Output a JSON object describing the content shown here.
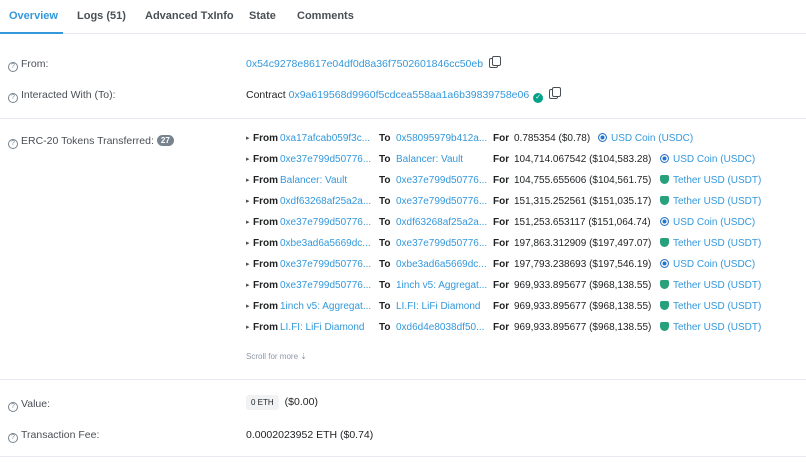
{
  "tabs": [
    {
      "label": "Overview"
    },
    {
      "label": "Logs (51)"
    },
    {
      "label": "Advanced TxInfo"
    },
    {
      "label": "State"
    },
    {
      "label": "Comments"
    }
  ],
  "from": {
    "label": "From:",
    "address": "0x54c9278e8617e04df0d8a36f7502601846cc50eb"
  },
  "interacted": {
    "label": "Interacted With (To):",
    "prefix": "Contract",
    "address": "0x9a619568d9960f5cdcea558aa1a6b39839758e06"
  },
  "erc20": {
    "label": "ERC-20 Tokens Transferred:",
    "count": "27",
    "kw_from": "From",
    "kw_to": "To",
    "kw_for": "For",
    "transfers": [
      {
        "from": "0xa17afcab059f3c...",
        "to": "0x58095979b412a...",
        "amount": "0.785354 ($0.78)",
        "token": "USD Coin (USDC)",
        "token_type": "usdc"
      },
      {
        "from": "0xe37e799d50776...",
        "to": "Balancer: Vault",
        "amount": "104,714.067542 ($104,583.28)",
        "token": "USD Coin (USDC)",
        "token_type": "usdc"
      },
      {
        "from": "Balancer: Vault",
        "to": "0xe37e799d50776...",
        "amount": "104,755.655606 ($104,561.75)",
        "token": "Tether USD (USDT)",
        "token_type": "usdt"
      },
      {
        "from": "0xdf63268af25a2a...",
        "to": "0xe37e799d50776...",
        "amount": "151,315.252561 ($151,035.17)",
        "token": "Tether USD (USDT)",
        "token_type": "usdt"
      },
      {
        "from": "0xe37e799d50776...",
        "to": "0xdf63268af25a2a...",
        "amount": "151,253.653117 ($151,064.74)",
        "token": "USD Coin (USDC)",
        "token_type": "usdc"
      },
      {
        "from": "0xbe3ad6a5669dc...",
        "to": "0xe37e799d50776...",
        "amount": "197,863.312909 ($197,497.07)",
        "token": "Tether USD (USDT)",
        "token_type": "usdt"
      },
      {
        "from": "0xe37e799d50776...",
        "to": "0xbe3ad6a5669dc...",
        "amount": "197,793.238693 ($197,546.19)",
        "token": "USD Coin (USDC)",
        "token_type": "usdc"
      },
      {
        "from": "0xe37e799d50776...",
        "to": "1inch v5: Aggregat...",
        "amount": "969,933.895677 ($968,138.55)",
        "token": "Tether USD (USDT)",
        "token_type": "usdt"
      },
      {
        "from": "1inch v5: Aggregat...",
        "to": "LI.FI: LiFi Diamond",
        "amount": "969,933.895677 ($968,138.55)",
        "token": "Tether USD (USDT)",
        "token_type": "usdt"
      },
      {
        "from": "LI.FI: LiFi Diamond",
        "to": "0xd6d4e8038df50...",
        "amount": "969,933.895677 ($968,138.55)",
        "token": "Tether USD (USDT)",
        "token_type": "usdt"
      }
    ],
    "scroll_more": "Scroll for more ⇣"
  },
  "value": {
    "label": "Value:",
    "eth": "0 ETH",
    "usd": "($0.00)"
  },
  "fee": {
    "label": "Transaction Fee:",
    "text": "0.0002023952 ETH ($0.74)"
  },
  "colors": {
    "accent": "#3498db",
    "usdc": "#2775ca",
    "usdt": "#26a17b",
    "verified": "#00a186"
  }
}
